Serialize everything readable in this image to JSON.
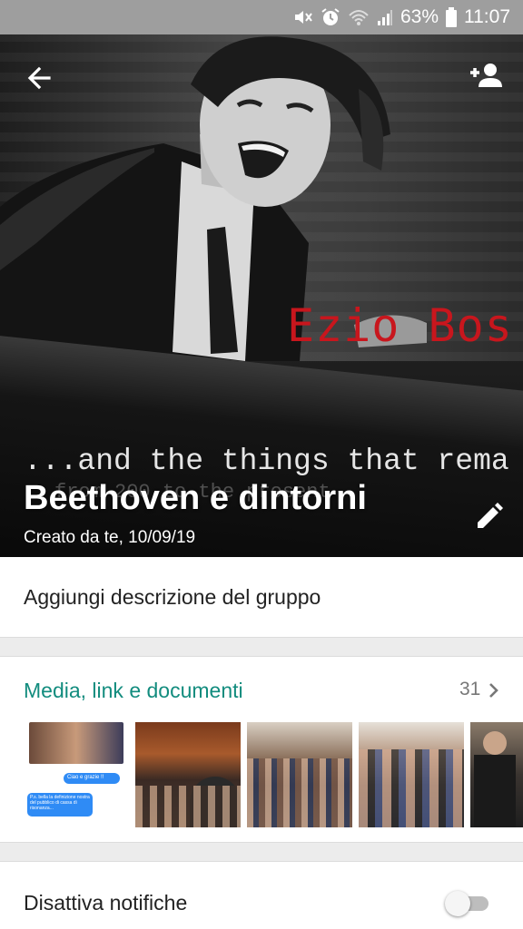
{
  "status_bar": {
    "battery_percent": "63%",
    "time": "11:07",
    "icons": [
      "mute-vibrate-icon",
      "alarm-icon",
      "wifi-icon",
      "signal-icon",
      "battery-icon"
    ]
  },
  "header": {
    "image_text_red": "Ezio Bos",
    "image_text_sub": "...and the things that rema",
    "image_text_faint": "from 200  to the present",
    "group_name": "Beethoven e dintorni",
    "created": "Creato da te, 10/09/19",
    "icons": [
      "back-arrow-icon",
      "add-person-icon",
      "edit-pencil-icon"
    ]
  },
  "description": {
    "placeholder": "Aggiungi descrizione del gruppo"
  },
  "media": {
    "title": "Media, link e documenti",
    "count": "31",
    "thumbnails": [
      {
        "kind": "chat-screenshot",
        "bubble1": "Ciao e grazie !!",
        "bubble2": "P.s. bella la definizione nostra del pubblico di cassa di risonanza..."
      },
      {
        "kind": "photo-audience"
      },
      {
        "kind": "photo-hall"
      },
      {
        "kind": "photo-group"
      },
      {
        "kind": "photo-person"
      }
    ]
  },
  "notifications": {
    "label": "Disattiva notifiche",
    "enabled": false
  },
  "colors": {
    "accent": "#128c7e",
    "status_bar": "#9e9e9e",
    "poster_red": "#c8161d"
  }
}
